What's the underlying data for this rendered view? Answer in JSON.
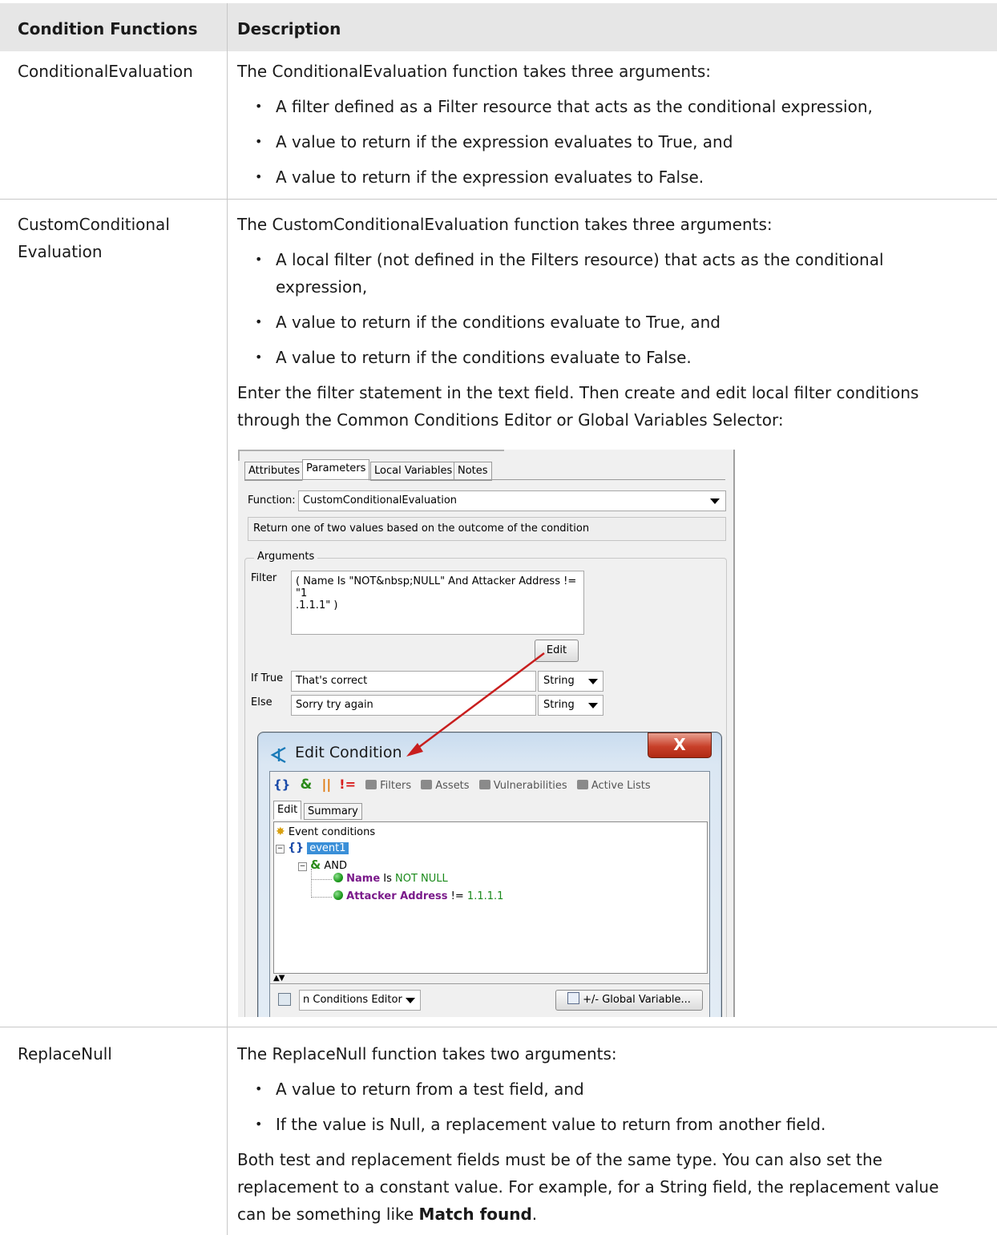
{
  "table": {
    "header": {
      "col1": "Condition Functions",
      "col2": "Description"
    },
    "rows": [
      {
        "name": "ConditionalEvaluation",
        "intro": "The ConditionalEvaluation function takes three arguments:",
        "bullets": [
          "A filter defined as a Filter resource that acts as the conditional expression,",
          "A value to return if the expression evaluates to True, and",
          "A value to return if the expression evaluates to False."
        ]
      },
      {
        "name_line1": "CustomConditional",
        "name_line2": "Evaluation",
        "intro": "The CustomConditionalEvaluation function takes three arguments:",
        "bullets": [
          "A local filter (not defined in the Filters resource) that acts as the conditional expression,",
          "A value to return if the conditions evaluate to True, and",
          "A value to return if the conditions evaluate to False."
        ],
        "after": "Enter the filter statement in the text field. Then create and edit local filter conditions through the Common Conditions Editor or Global Variables Selector:"
      },
      {
        "name": "ReplaceNull",
        "intro": "The ReplaceNull function takes two arguments:",
        "bullets": [
          "A value to return from a test field, and",
          "If the value is Null, a replacement value to return from another field."
        ],
        "after_prefix": "Both test and replacement fields must be of the same type. You can also set the replacement to a constant value. For example, for a String field, the replacement value can be something like ",
        "after_bold": "Match found",
        "after_suffix": "."
      }
    ]
  },
  "screenshot": {
    "tabs": [
      "Attributes",
      "Parameters",
      "Local Variables",
      "Notes"
    ],
    "function_label": "Function:",
    "function_value": "CustomConditionalEvaluation",
    "function_desc": "Return one of two values based on the outcome of the condition",
    "arguments_label": "Arguments",
    "filter_label": "Filter",
    "filter_line1": "( Name Is \"NOT&nbsp;NULL\" And Attacker Address != \"1",
    "filter_line2": ".1.1.1\" )",
    "edit_button": "Edit",
    "iftrue_label": "If True",
    "iftrue_value": "That's correct",
    "else_label": "Else",
    "else_value": "Sorry try again",
    "type_value": "String",
    "dialog": {
      "title": "Edit Condition",
      "close": "X",
      "toolbar": [
        "Filters",
        "Assets",
        "Vulnerabilities",
        "Active Lists"
      ],
      "tabs": [
        "Edit",
        "Summary"
      ],
      "tree": {
        "root": "Event conditions",
        "event": "event1",
        "op": "AND",
        "cond1_field": "Name",
        "cond1_op": " Is ",
        "cond1_value": "NOT NULL",
        "cond2_field": "Attacker Address",
        "cond2_op": " != ",
        "cond2_value": "1.1.1.1"
      },
      "editor_select": "n Conditions Editor",
      "global_button": "+/- Global Variable..."
    },
    "colors": {
      "arrow": "#c81e1e",
      "selection": "#3a8fd8",
      "close": "#c8402a"
    }
  }
}
